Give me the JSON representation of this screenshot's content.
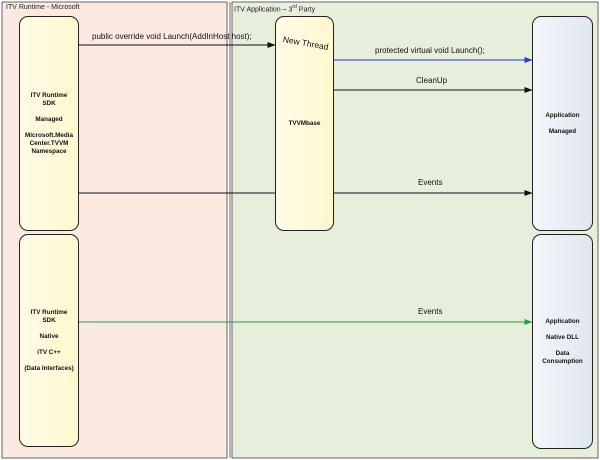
{
  "zones": {
    "left_title": "ITV Runtime - Microsoft",
    "right_title": "ITV Application – 3rd Party",
    "left_color": "#fbe9e2",
    "right_color": "#e7eedc"
  },
  "boxes": {
    "runtime_managed": [
      "ITV Runtime",
      "SDK",
      "",
      "Managed",
      "",
      "Microsoft.Media",
      "Center.TVVM",
      "Namespace"
    ],
    "runtime_native": [
      "ITV Runtime",
      "SDK",
      "",
      "Native",
      "",
      "iTV C++",
      "",
      "(Data Interfaces)"
    ],
    "tvvmbase": [
      "TVVMbase"
    ],
    "app_managed": [
      "Application",
      "",
      "Managed"
    ],
    "app_native": [
      "Application",
      "",
      "Native DLL",
      "",
      "Data",
      "Consumption"
    ]
  },
  "connections": {
    "launch": "public override void Launch(AddInHost host);",
    "new_thread": "New Thread",
    "protected_launch": "protected virtual void Launch();",
    "cleanup": "CleanUp",
    "events_managed": "Events",
    "events_native": "Events"
  },
  "colors": {
    "arrow_default": "#111111",
    "arrow_thread": "#1f3fd6",
    "arrow_native_events": "#2a9d4a"
  }
}
